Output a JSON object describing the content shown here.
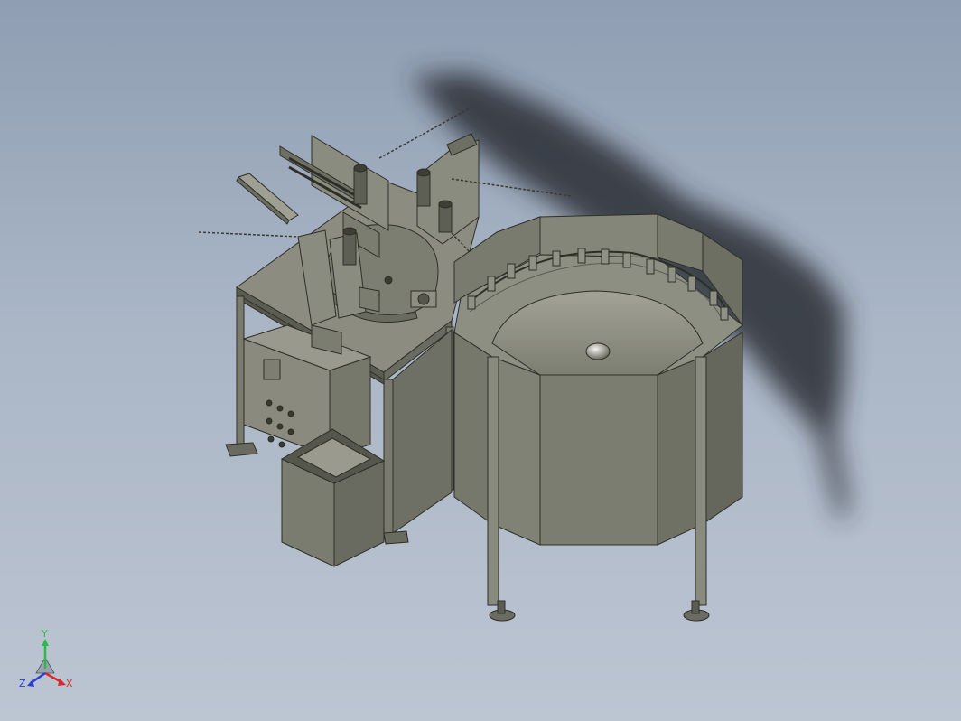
{
  "viewport": {
    "background_top": "#8f9eb3",
    "background_bottom": "#bcc5d2",
    "model_color": "#7a7a6c",
    "edge_color": "#2e2e28",
    "shadow_color": "#2b2f36"
  },
  "triad": {
    "x_label": "X",
    "y_label": "Y",
    "z_label": "Z",
    "x_color": "#d9292b",
    "y_color": "#2fb84a",
    "z_color": "#2a3fd1"
  }
}
